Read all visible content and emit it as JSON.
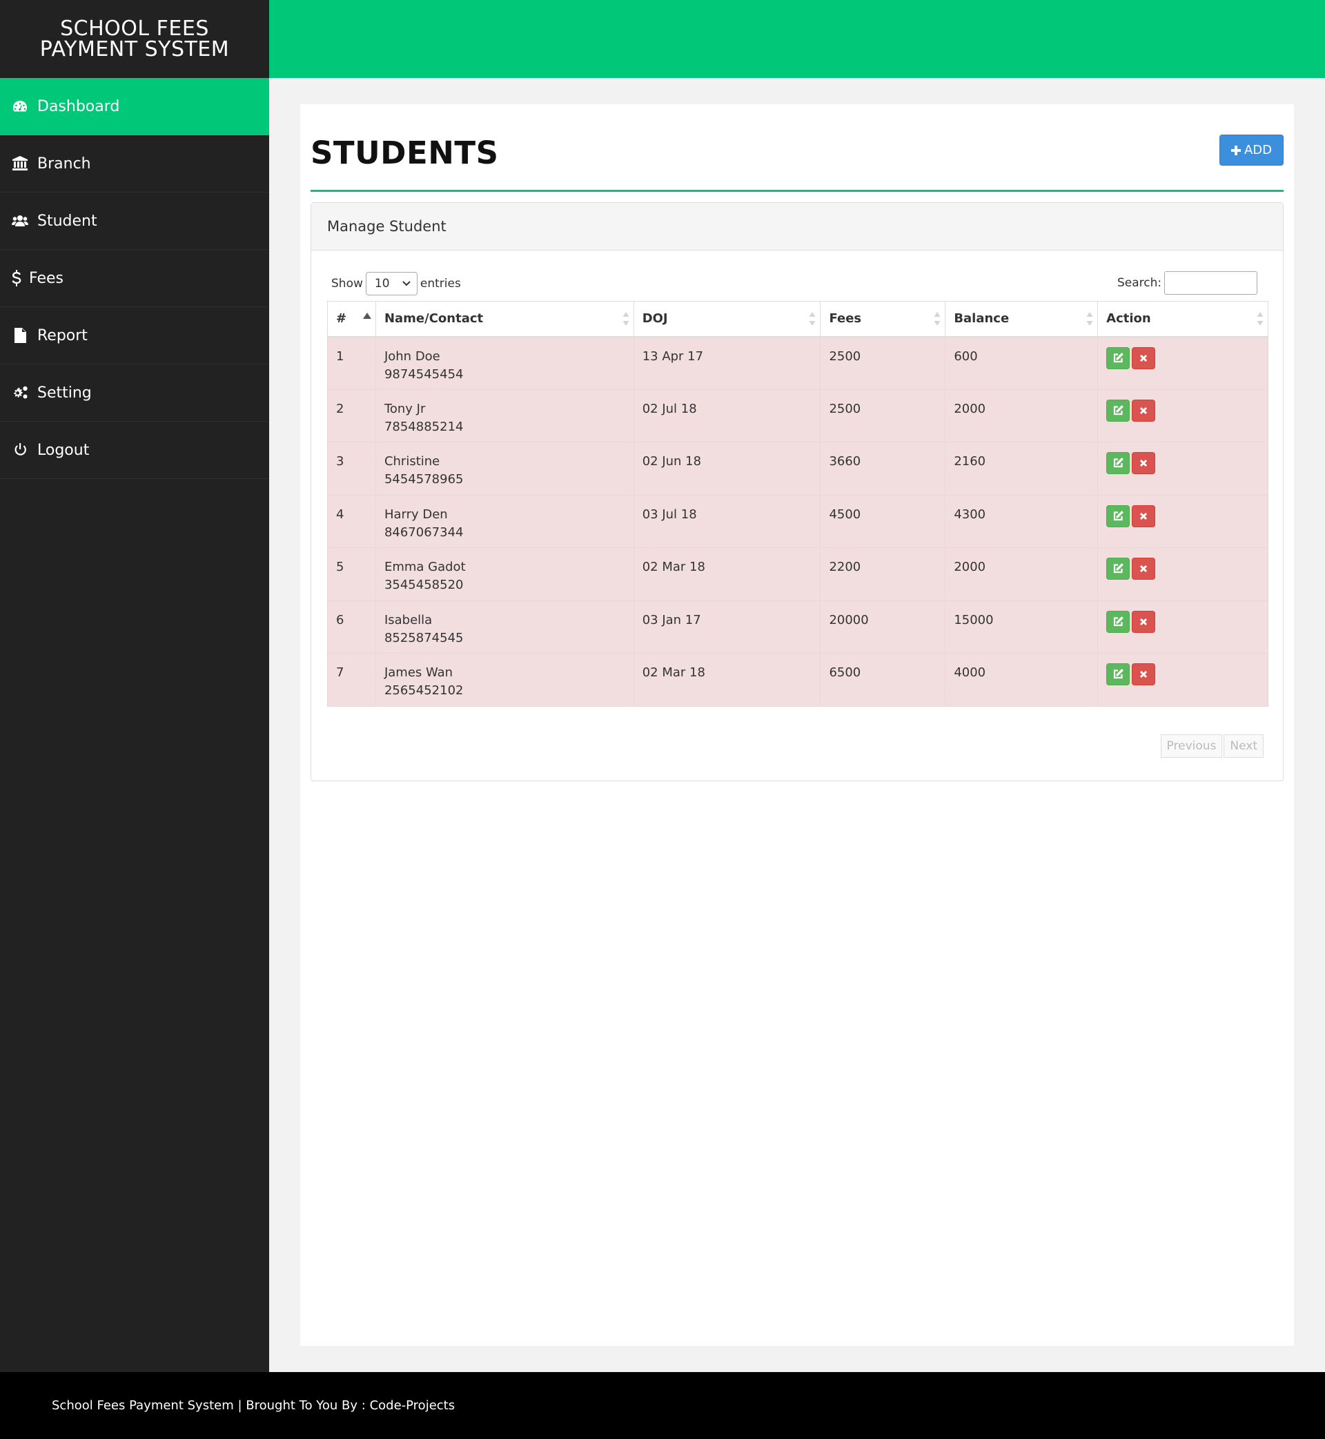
{
  "brand": {
    "title": "SCHOOL FEES\nPAYMENT SYSTEM"
  },
  "sidebar": {
    "items": [
      {
        "label": "Dashboard",
        "icon": "dashboard-icon",
        "active": true
      },
      {
        "label": "Branch",
        "icon": "bank-icon"
      },
      {
        "label": "Student",
        "icon": "users-icon"
      },
      {
        "label": "Fees",
        "icon": "dollar-icon"
      },
      {
        "label": "Report",
        "icon": "file-icon"
      },
      {
        "label": "Setting",
        "icon": "gears-icon"
      },
      {
        "label": "Logout",
        "icon": "power-icon"
      }
    ]
  },
  "main": {
    "title": "STUDENTS",
    "add_label": "ADD",
    "panel_heading": "Manage Student",
    "show_label": "Show",
    "entries_value": "10",
    "entries_label": "entries",
    "search_label": "Search:",
    "search_value": "",
    "columns": [
      "#",
      "Name/Contact",
      "DOJ",
      "Fees",
      "Balance",
      "Action"
    ],
    "rows": [
      {
        "num": "1",
        "name": "John Doe",
        "contact": "9874545454",
        "doj": "13 Apr 17",
        "fees": "2500",
        "balance": "600"
      },
      {
        "num": "2",
        "name": "Tony Jr",
        "contact": "7854885214",
        "doj": "02 Jul 18",
        "fees": "2500",
        "balance": "2000"
      },
      {
        "num": "3",
        "name": "Christine",
        "contact": "5454578965",
        "doj": "02 Jun 18",
        "fees": "3660",
        "balance": "2160"
      },
      {
        "num": "4",
        "name": "Harry Den",
        "contact": "8467067344",
        "doj": "03 Jul 18",
        "fees": "4500",
        "balance": "4300"
      },
      {
        "num": "5",
        "name": "Emma Gadot",
        "contact": "3545458520",
        "doj": "02 Mar 18",
        "fees": "2200",
        "balance": "2000"
      },
      {
        "num": "6",
        "name": "Isabella",
        "contact": "8525874545",
        "doj": "03 Jan 17",
        "fees": "20000",
        "balance": "15000"
      },
      {
        "num": "7",
        "name": "James Wan",
        "contact": "2565452102",
        "doj": "02 Mar 18",
        "fees": "6500",
        "balance": "4000"
      }
    ],
    "pager": {
      "previous": "Previous",
      "next": "Next"
    }
  },
  "footer": {
    "text": "School Fees Payment System | Brought To You By : Code-Projects"
  },
  "colors": {
    "accent": "#00c878",
    "sidebar": "#222222",
    "add_button": "#3c8fdc",
    "row_danger": "#f2dede",
    "edit": "#5cb85c",
    "delete": "#d9534f"
  }
}
